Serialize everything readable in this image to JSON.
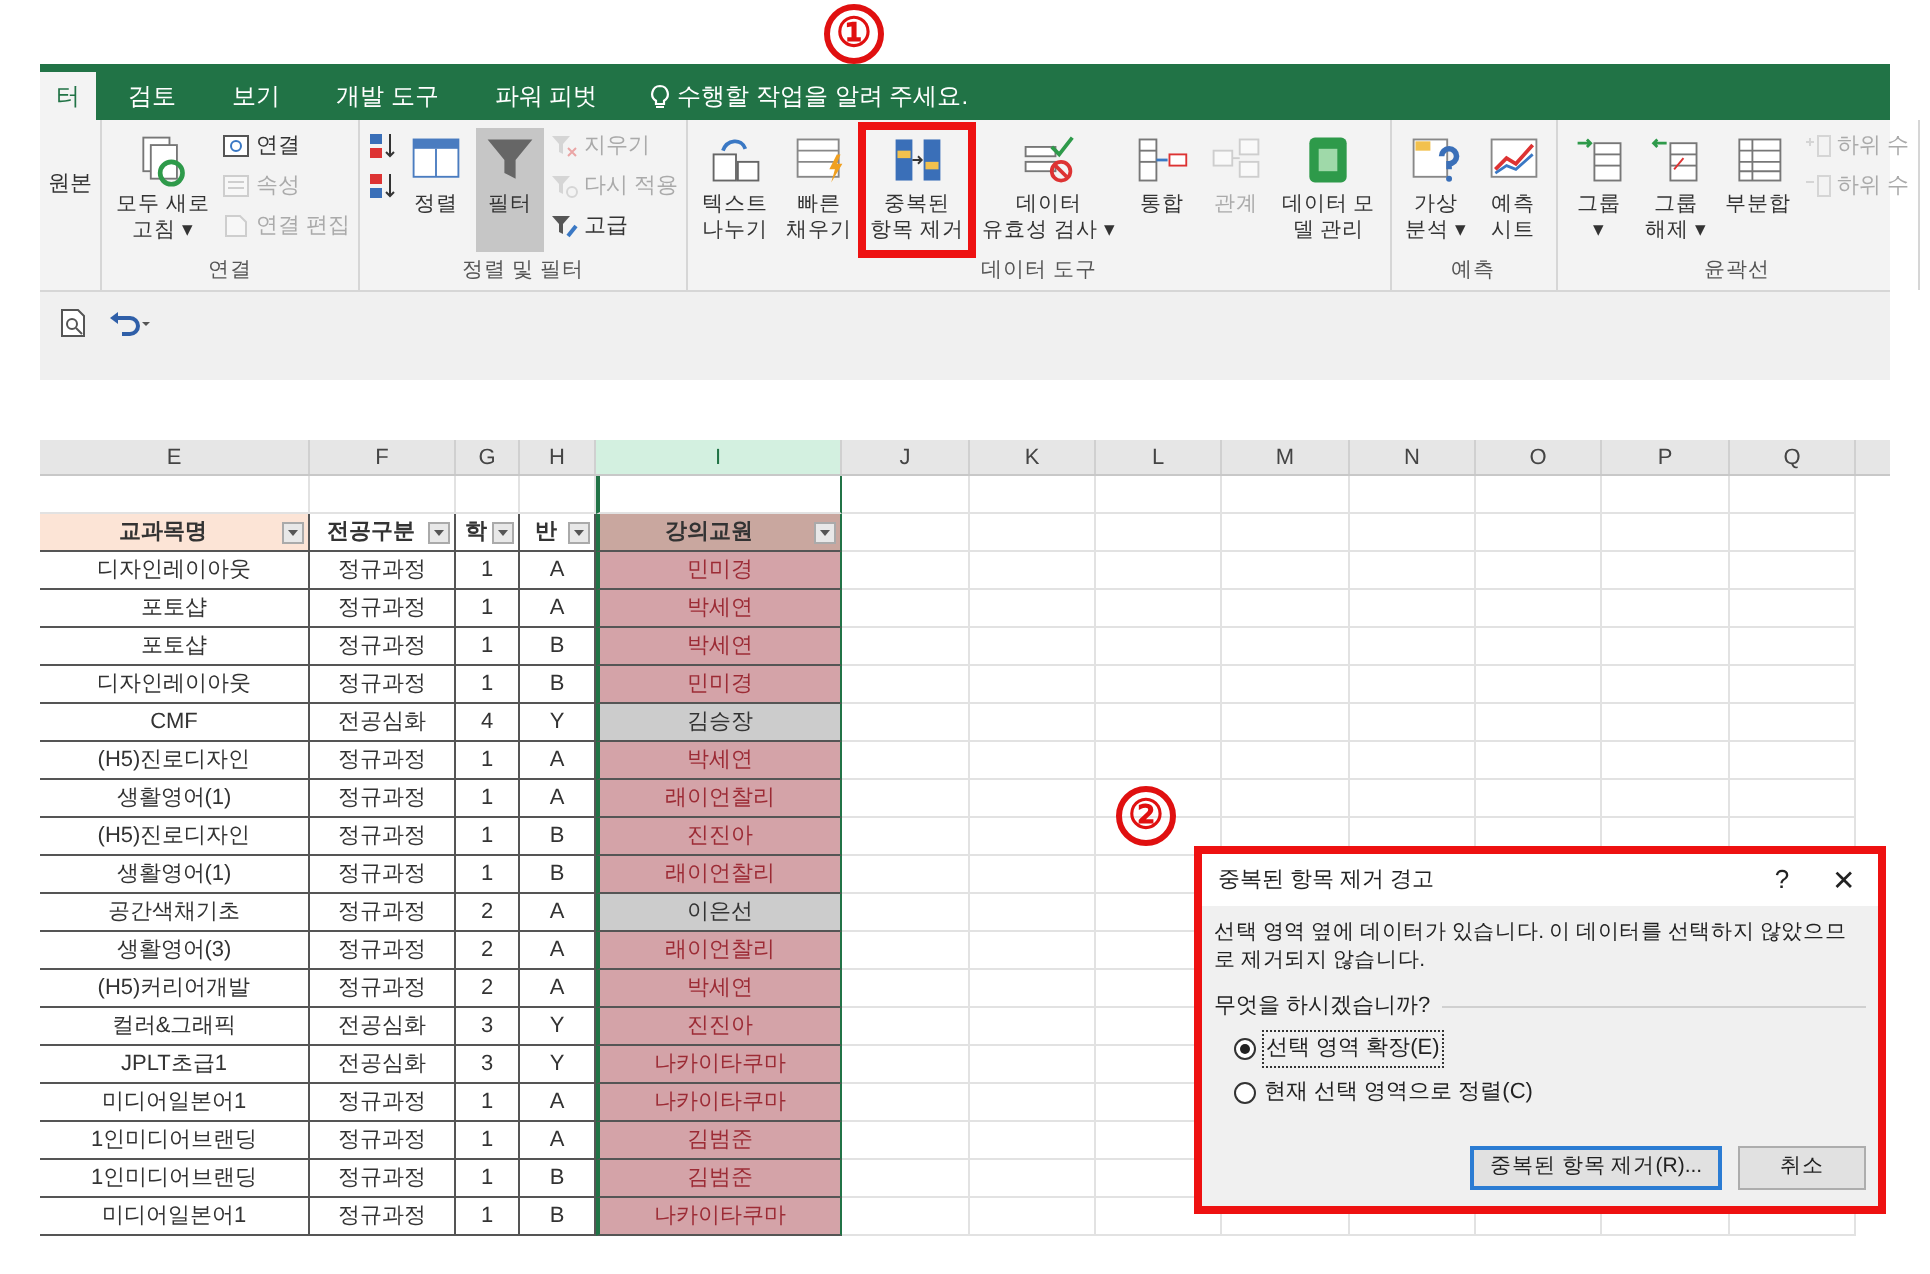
{
  "tabs": [
    {
      "label": "터",
      "selected": true
    },
    {
      "label": "검토",
      "selected": false
    },
    {
      "label": "보기",
      "selected": false
    },
    {
      "label": "개발 도구",
      "selected": false
    },
    {
      "label": "파워 피벗",
      "selected": false
    }
  ],
  "tell_me": "수행할 작업을 알려 주세요.",
  "ribbon": {
    "groups": [
      {
        "items": [
          {
            "kind": "stack",
            "items": [
              {
                "label": "원본",
                "disabled": false
              }
            ]
          }
        ]
      },
      {
        "label": "연결",
        "items": [
          {
            "kind": "large",
            "lines": [
              "모두 새로",
              "고침 ▾"
            ],
            "pressed": false,
            "disabled": false,
            "marked": false
          },
          {
            "kind": "stack",
            "items": [
              {
                "label": "연결",
                "disabled": false
              },
              {
                "label": "속성",
                "disabled": true
              },
              {
                "label": "연결 편집",
                "disabled": true
              }
            ]
          }
        ]
      },
      {
        "label": "정렬 및 필터",
        "items": [
          {
            "kind": "stack",
            "items": [
              {
                "disabled": false
              },
              {
                "disabled": false
              }
            ]
          },
          {
            "kind": "large",
            "lines": [
              "정렬"
            ],
            "pressed": false,
            "disabled": false,
            "marked": false
          },
          {
            "kind": "large",
            "lines": [
              "필터"
            ],
            "pressed": true,
            "disabled": false,
            "marked": false
          },
          {
            "kind": "stack",
            "items": [
              {
                "label": "지우기",
                "disabled": true
              },
              {
                "label": "다시 적용",
                "disabled": true
              },
              {
                "label": "고급",
                "disabled": false
              }
            ]
          }
        ]
      },
      {
        "label": "데이터 도구",
        "items": [
          {
            "kind": "large",
            "lines": [
              "텍스트",
              "나누기"
            ],
            "pressed": false,
            "disabled": false,
            "marked": false
          },
          {
            "kind": "large",
            "lines": [
              "빠른",
              "채우기"
            ],
            "pressed": false,
            "disabled": false,
            "marked": false
          },
          {
            "kind": "large",
            "lines": [
              "중복된",
              "항목 제거"
            ],
            "pressed": false,
            "disabled": false,
            "marked": true
          },
          {
            "kind": "large",
            "lines": [
              "데이터",
              "유효성 검사 ▾"
            ],
            "pressed": false,
            "disabled": false,
            "marked": false
          },
          {
            "kind": "large",
            "lines": [
              "통합"
            ],
            "pressed": false,
            "disabled": false,
            "marked": false
          },
          {
            "kind": "large",
            "lines": [
              "관계"
            ],
            "pressed": false,
            "disabled": true,
            "marked": false
          },
          {
            "kind": "large",
            "lines": [
              "데이터 모",
              "델 관리"
            ],
            "pressed": false,
            "disabled": false,
            "marked": false
          }
        ]
      },
      {
        "label": "예측",
        "items": [
          {
            "kind": "large",
            "lines": [
              "가상",
              "분석 ▾"
            ],
            "pressed": false,
            "disabled": false,
            "marked": false
          },
          {
            "kind": "large",
            "lines": [
              "예측",
              "시트"
            ],
            "pressed": false,
            "disabled": false,
            "marked": false
          }
        ]
      },
      {
        "label": "윤곽선",
        "items": [
          {
            "kind": "large",
            "lines": [
              "그룹",
              "▾"
            ],
            "pressed": false,
            "disabled": false,
            "marked": false
          },
          {
            "kind": "large",
            "lines": [
              "그룹",
              "해제 ▾"
            ],
            "pressed": false,
            "disabled": false,
            "marked": false
          },
          {
            "kind": "large",
            "lines": [
              "부분합"
            ],
            "pressed": false,
            "disabled": false,
            "marked": false
          },
          {
            "kind": "stack",
            "items": [
              {
                "label": "하위 수",
                "disabled": true
              },
              {
                "label": "하위 수",
                "disabled": true
              }
            ]
          }
        ]
      }
    ]
  },
  "sheet": {
    "columns": [
      {
        "label": "E",
        "selected": false
      },
      {
        "label": "F",
        "selected": false
      },
      {
        "label": "G",
        "selected": false
      },
      {
        "label": "H",
        "selected": false
      },
      {
        "label": "I",
        "selected": true
      },
      {
        "label": "J",
        "selected": false
      },
      {
        "label": "K",
        "selected": false
      },
      {
        "label": "L",
        "selected": false
      },
      {
        "label": "M",
        "selected": false
      },
      {
        "label": "N",
        "selected": false
      },
      {
        "label": "O",
        "selected": false
      },
      {
        "label": "P",
        "selected": false
      },
      {
        "label": "Q",
        "selected": false
      }
    ],
    "header": [
      {
        "text": "교과목명",
        "color": "#fce4d6"
      },
      {
        "text": "전공구분",
        "color": "#ffffff"
      },
      {
        "text": "학",
        "color": "#ffffff"
      },
      {
        "text": "반",
        "color": "#ffffff"
      },
      {
        "text": "강의교원",
        "color": "#c9a79f"
      }
    ],
    "rows": [
      {
        "cells": [
          "디자인레이아웃",
          "정규과정",
          "1",
          "A",
          "민미경"
        ],
        "duplicate": true
      },
      {
        "cells": [
          "포토샵",
          "정규과정",
          "1",
          "A",
          "박세연"
        ],
        "duplicate": true
      },
      {
        "cells": [
          "포토샵",
          "정규과정",
          "1",
          "B",
          "박세연"
        ],
        "duplicate": true
      },
      {
        "cells": [
          "디자인레이아웃",
          "정규과정",
          "1",
          "B",
          "민미경"
        ],
        "duplicate": true
      },
      {
        "cells": [
          "CMF",
          "전공심화",
          "4",
          "Y",
          "김승장"
        ],
        "duplicate": false
      },
      {
        "cells": [
          "(H5)진로디자인",
          "정규과정",
          "1",
          "A",
          "박세연"
        ],
        "duplicate": true
      },
      {
        "cells": [
          "생활영어(1)",
          "정규과정",
          "1",
          "A",
          "래이언찰리"
        ],
        "duplicate": true
      },
      {
        "cells": [
          "(H5)진로디자인",
          "정규과정",
          "1",
          "B",
          "진진아"
        ],
        "duplicate": true
      },
      {
        "cells": [
          "생활영어(1)",
          "정규과정",
          "1",
          "B",
          "래이언찰리"
        ],
        "duplicate": true
      },
      {
        "cells": [
          "공간색채기초",
          "정규과정",
          "2",
          "A",
          "이은선"
        ],
        "duplicate": false
      },
      {
        "cells": [
          "생활영어(3)",
          "정규과정",
          "2",
          "A",
          "래이언찰리"
        ],
        "duplicate": true
      },
      {
        "cells": [
          "(H5)커리어개발",
          "정규과정",
          "2",
          "A",
          "박세연"
        ],
        "duplicate": true
      },
      {
        "cells": [
          "컬러&그래픽",
          "전공심화",
          "3",
          "Y",
          "진진아"
        ],
        "duplicate": true
      },
      {
        "cells": [
          "JPLT초급1",
          "전공심화",
          "3",
          "Y",
          "나카이타쿠마"
        ],
        "duplicate": true
      },
      {
        "cells": [
          "미디어일본어1",
          "정규과정",
          "1",
          "A",
          "나카이타쿠마"
        ],
        "duplicate": true
      },
      {
        "cells": [
          "1인미디어브랜딩",
          "정규과정",
          "1",
          "A",
          "김범준"
        ],
        "duplicate": true
      },
      {
        "cells": [
          "1인미디어브랜딩",
          "정규과정",
          "1",
          "B",
          "김범준"
        ],
        "duplicate": true
      },
      {
        "cells": [
          "미디어일본어1",
          "정규과정",
          "1",
          "B",
          "나카이타쿠마"
        ],
        "duplicate": true
      }
    ]
  },
  "annotations": [
    {
      "label": "①"
    },
    {
      "label": "②"
    }
  ],
  "dialog": {
    "title": "중복된 항목 제거 경고",
    "help": "?",
    "close": "✕",
    "message": "선택 영역 옆에 데이터가 있습니다. 이 데이터를 선택하지 않았으므로 제거되지 않습니다.",
    "question": "무엇을 하시겠습니까?",
    "options": [
      {
        "label": "선택 영역 확장(E)",
        "selected": true
      },
      {
        "label": "현재 선택 영역으로 정렬(C)",
        "selected": false
      }
    ],
    "buttons": [
      {
        "label": "중복된 항목 제거(R)...",
        "default": true
      },
      {
        "label": "취소",
        "default": false
      }
    ]
  }
}
